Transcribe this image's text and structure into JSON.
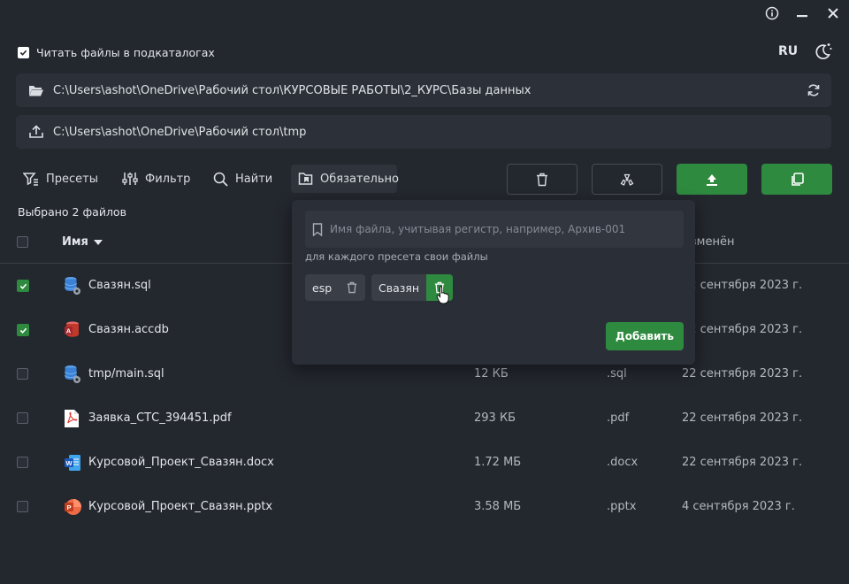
{
  "window": {
    "info_icon": "info-icon",
    "minimize_icon": "minimize-icon",
    "close_icon": "close-icon"
  },
  "options": {
    "subdirs_label": "Читать файлы в подкаталогах",
    "subdirs_checked": true,
    "language": "RU",
    "theme_icon": "moon-sun-icon"
  },
  "paths": {
    "source": "C:\\Users\\ashot\\OneDrive\\Рабочий стол\\КУРСОВЫЕ РАБОТЫ\\2_КУРС\\Базы данных",
    "destination": "C:\\Users\\ashot\\OneDrive\\Рабочий стол\\tmp"
  },
  "toolbar": {
    "presets": "Пресеты",
    "filter": "Фильтр",
    "find": "Найти",
    "required": "Обязательно"
  },
  "selection": {
    "text": "Выбрано 2 файлов"
  },
  "table": {
    "headers": {
      "name": "Имя",
      "modified": "Изменён"
    },
    "rows": [
      {
        "checked": true,
        "icon": "sql-file-icon",
        "name": "Свазян.sql",
        "size": "",
        "ext": "",
        "date": "22 сентября 2023 г."
      },
      {
        "checked": true,
        "icon": "access-file-icon",
        "name": "Свазян.accdb",
        "size": "",
        "ext": "",
        "date": "22 сентября 2023 г."
      },
      {
        "checked": false,
        "icon": "sql-file-icon",
        "name": "tmp/main.sql",
        "size": "12 КБ",
        "ext": ".sql",
        "date": "22 сентября 2023 г."
      },
      {
        "checked": false,
        "icon": "pdf-file-icon",
        "name": "Заявка_СТС_394451.pdf",
        "size": "293 КБ",
        "ext": ".pdf",
        "date": "22 сентября 2023 г."
      },
      {
        "checked": false,
        "icon": "word-file-icon",
        "name": "Курсовой_Проект_Свазян.docx",
        "size": "1.72 МБ",
        "ext": ".docx",
        "date": "22 сентября 2023 г."
      },
      {
        "checked": false,
        "icon": "powerpoint-file-icon",
        "name": "Курсовой_Проект_Свазян.pptx",
        "size": "3.58 МБ",
        "ext": ".pptx",
        "date": "4 сентября 2023 г."
      }
    ]
  },
  "required_panel": {
    "placeholder": "Имя файла, учитывая регистр, например, Архив-001",
    "hint": "для каждого пресета свои файлы",
    "chips": [
      "esp",
      "Свазян"
    ],
    "add_label": "Добавить"
  },
  "colors": {
    "background": "#23272e",
    "panel": "#2c3139",
    "accent_green": "#2e8a3f"
  }
}
